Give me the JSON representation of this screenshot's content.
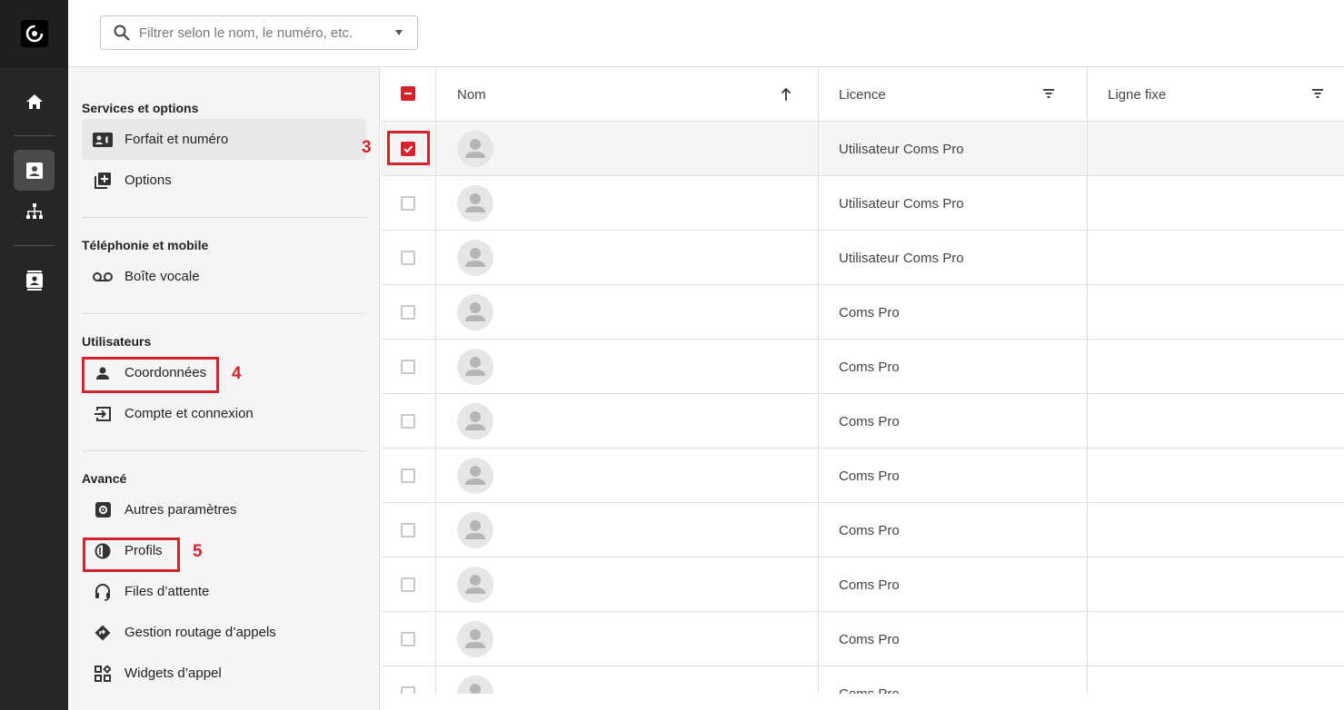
{
  "search": {
    "placeholder": "Filtrer selon le nom, le numéro, etc."
  },
  "menu": {
    "sections": [
      {
        "heading": "Services et options",
        "items": [
          "Forfait et numéro",
          "Options"
        ]
      },
      {
        "heading": "Téléphonie et mobile",
        "items": [
          "Boîte vocale"
        ]
      },
      {
        "heading": "Utilisateurs",
        "items": [
          "Coordonnées",
          "Compte et connexion"
        ]
      },
      {
        "heading": "Avancé",
        "items": [
          "Autres paramètres",
          "Profils",
          "Files d’attente",
          "Gestion routage d’appels",
          "Widgets d’appel"
        ]
      }
    ]
  },
  "annotations": {
    "three": "3",
    "four": "4",
    "five": "5"
  },
  "table": {
    "columns": {
      "name": "Nom",
      "licence": "Licence",
      "fixed_line": "Ligne fixe"
    },
    "rows": [
      {
        "licence": "Utilisateur Coms Pro",
        "checked": true
      },
      {
        "licence": "Utilisateur Coms Pro",
        "checked": false
      },
      {
        "licence": "Utilisateur Coms Pro",
        "checked": false
      },
      {
        "licence": "Coms Pro",
        "checked": false
      },
      {
        "licence": "Coms Pro",
        "checked": false
      },
      {
        "licence": "Coms Pro",
        "checked": false
      },
      {
        "licence": "Coms Pro",
        "checked": false
      },
      {
        "licence": "Coms Pro",
        "checked": false
      },
      {
        "licence": "Coms Pro",
        "checked": false
      },
      {
        "licence": "Coms Pro",
        "checked": false
      },
      {
        "licence": "Coms Pro",
        "checked": false
      }
    ]
  },
  "colors": {
    "accent": "#d6222a",
    "rail": "#262626"
  }
}
